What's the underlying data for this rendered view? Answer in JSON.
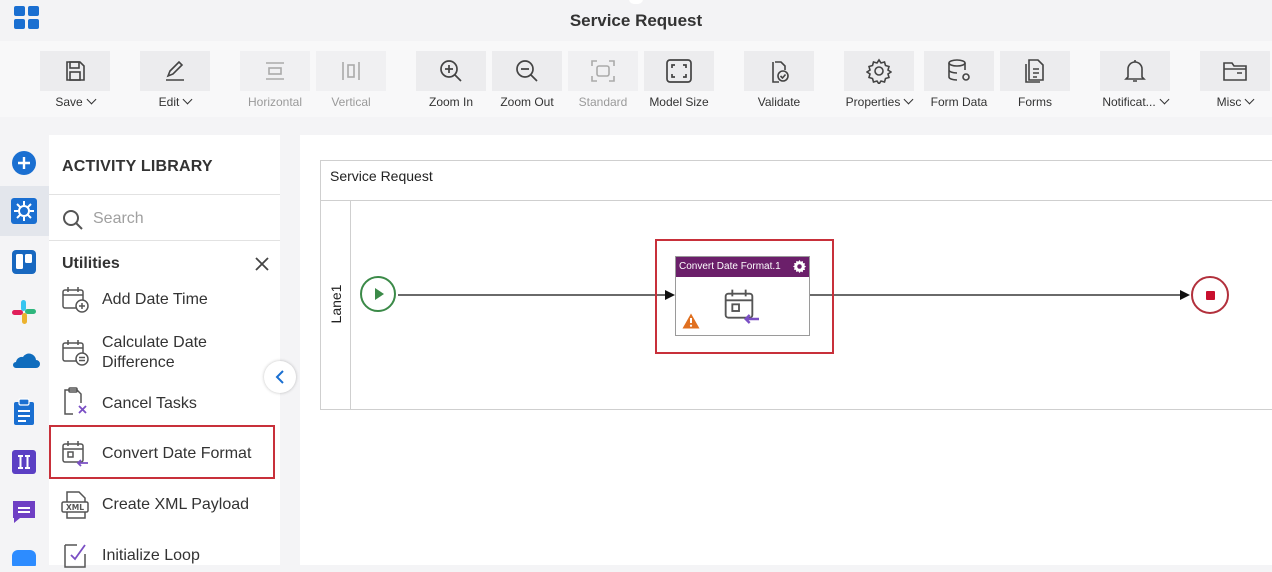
{
  "window": {
    "title": "Service Request"
  },
  "toolbar": {
    "buttons": [
      {
        "id": "save",
        "label": "Save",
        "icon": "save-icon",
        "dropdown": true
      },
      {
        "id": "edit",
        "label": "Edit",
        "icon": "pencil-icon",
        "dropdown": true
      },
      {
        "id": "horizontal",
        "label": "Horizontal",
        "icon": "horizontal-layout-icon",
        "disabled": true
      },
      {
        "id": "vertical",
        "label": "Vertical",
        "icon": "vertical-layout-icon",
        "disabled": true
      },
      {
        "id": "zoom_in",
        "label": "Zoom In",
        "icon": "zoom-in-icon"
      },
      {
        "id": "zoom_out",
        "label": "Zoom Out",
        "icon": "zoom-out-icon"
      },
      {
        "id": "standard",
        "label": "Standard",
        "icon": "standard-size-icon",
        "disabled": true
      },
      {
        "id": "model_size",
        "label": "Model Size",
        "icon": "model-size-icon"
      },
      {
        "id": "validate",
        "label": "Validate",
        "icon": "validate-icon"
      },
      {
        "id": "properties",
        "label": "Properties",
        "icon": "gear-icon",
        "dropdown": true
      },
      {
        "id": "form_data",
        "label": "Form Data",
        "icon": "database-icon"
      },
      {
        "id": "forms",
        "label": "Forms",
        "icon": "forms-icon"
      },
      {
        "id": "notifications",
        "label": "Notificat...",
        "icon": "bell-icon",
        "dropdown": true
      },
      {
        "id": "misc",
        "label": "Misc",
        "icon": "folder-icon",
        "dropdown": true
      }
    ]
  },
  "library": {
    "title": "ACTIVITY LIBRARY",
    "search_placeholder": "Search",
    "category": "Utilities",
    "items": [
      {
        "label": "Add Date Time",
        "icon": "calendar-add-icon"
      },
      {
        "label": "Calculate Date Difference",
        "icon": "calendar-difference-icon"
      },
      {
        "label": "Cancel Tasks",
        "icon": "cancel-tasks-icon"
      },
      {
        "label": "Convert Date Format",
        "icon": "calendar-convert-icon",
        "selected": true
      },
      {
        "label": "Create XML Payload",
        "icon": "xml-icon"
      },
      {
        "label": "Initialize Loop",
        "icon": "loop-icon"
      }
    ]
  },
  "canvas": {
    "pool_title": "Service Request",
    "lane_title": "Lane1",
    "task": {
      "name": "Convert Date Format.1",
      "warning": true
    }
  },
  "colors": {
    "accent_red": "#c8303a",
    "task_header": "#6b1f6a",
    "start_event": "#3b8a48",
    "end_event": "#b2303c",
    "icon_blue": "#1a6fd1"
  }
}
